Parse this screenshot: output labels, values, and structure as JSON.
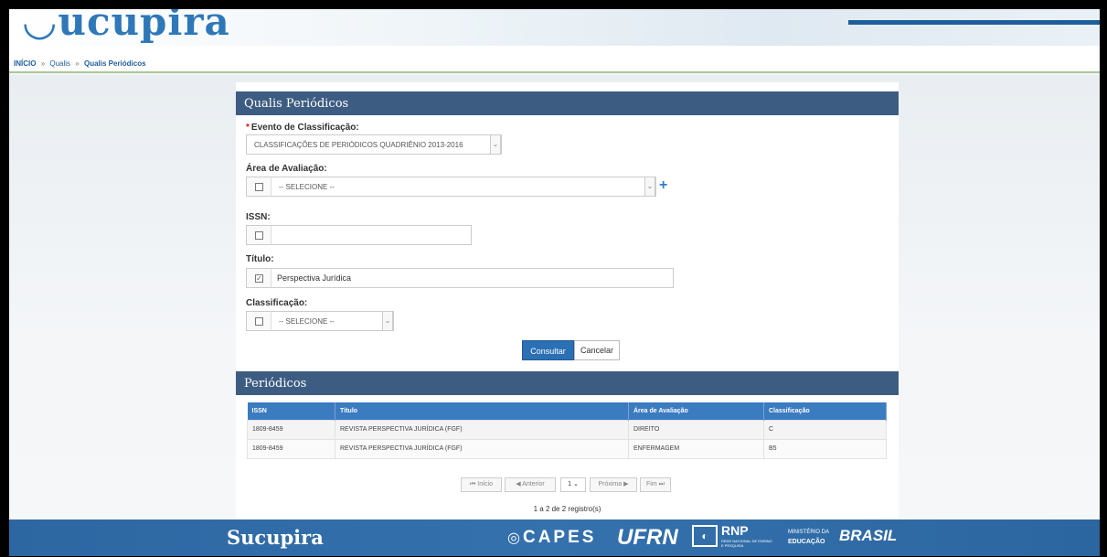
{
  "header": {
    "logo_text": "ucupira"
  },
  "breadcrumb": {
    "home": "INÍCIO",
    "sep": "»",
    "level1": "Qualis",
    "current": "Qualis Periódicos"
  },
  "form": {
    "panel_title": "Qualis Periódicos",
    "evento": {
      "label": "Evento de Classificação:",
      "value": "CLASSIFICAÇÕES DE PERIÓDICOS QUADRIÊNIO 2013-2016"
    },
    "area": {
      "label": "Área de Avaliação:",
      "value": "-- SELECIONE --",
      "checked": false
    },
    "issn": {
      "label": "ISSN:",
      "value": "",
      "checked": false
    },
    "titulo": {
      "label": "Título:",
      "value": "Perspectiva Jurídica",
      "checked": true
    },
    "classificacao": {
      "label": "Classificação:",
      "value": "-- SELECIONE --",
      "checked": false
    },
    "submit_label": "Consultar",
    "cancel_label": "Cancelar"
  },
  "results": {
    "panel_title": "Periódicos",
    "columns": [
      "ISSN",
      "Título",
      "Área de Avaliação",
      "Classificação"
    ],
    "rows": [
      [
        "1809-8459",
        "REVISTA PERSPECTIVA JURÍDICA (FGF)",
        "DIREITO",
        "C"
      ],
      [
        "1809-8459",
        "REVISTA PERSPECTIVA JURÍDICA (FGF)",
        "ENFERMAGEM",
        "B5"
      ]
    ],
    "pager": {
      "first": "⏮ Início",
      "prev": "◀ Anterior",
      "page": "1",
      "next": "Próxima ▶",
      "last": "Fim ⏭"
    },
    "count": "1 a 2 de 2 registro(s)"
  },
  "footer": {
    "sucupira": "Sucupira",
    "capes": "CAPES",
    "ufrn": "UFRN",
    "rnp": "RNP",
    "rnp_sub": "REDE NACIONAL DE ENSINO E PESQUISA",
    "ministerio": "MINISTÉRIO DA",
    "educacao": "EDUCAÇÃO",
    "brasil": "BRASIL"
  }
}
